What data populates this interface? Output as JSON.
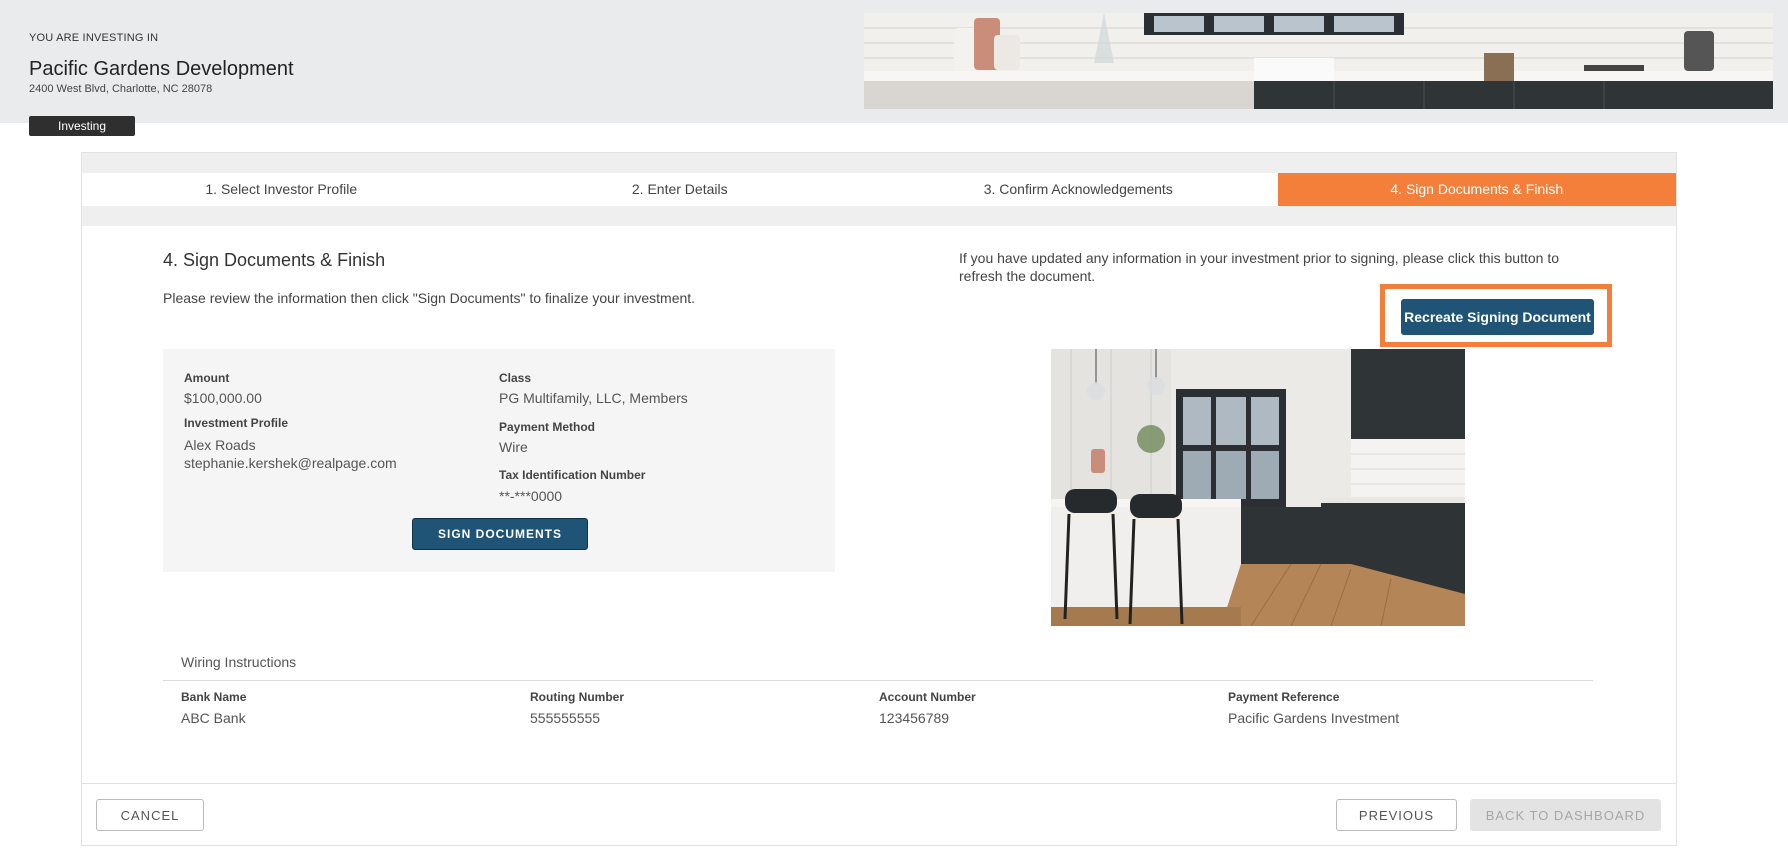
{
  "hero": {
    "kicker": "YOU ARE INVESTING IN",
    "title": "Pacific Gardens Development",
    "address": "2400 West Blvd, Charlotte, NC 28078",
    "badge": "Investing"
  },
  "steps": [
    {
      "label": "1. Select Investor Profile",
      "active": false
    },
    {
      "label": "2. Enter Details",
      "active": false
    },
    {
      "label": "3. Confirm Acknowledgements",
      "active": false
    },
    {
      "label": "4. Sign Documents & Finish",
      "active": true
    }
  ],
  "section": {
    "title": "4. Sign Documents & Finish",
    "description": "Please review the information then click \"Sign Documents\" to finalize your investment."
  },
  "summary": {
    "amount_label": "Amount",
    "amount": "$100,000.00",
    "profile_label": "Investment Profile",
    "profile_name": "Alex Roads",
    "profile_email": "stephanie.kershek@realpage.com",
    "class_label": "Class",
    "class": "PG Multifamily, LLC, Members",
    "payment_label": "Payment Method",
    "payment": "Wire",
    "tin_label": "Tax Identification Number",
    "tin": "**-***0000",
    "sign_button": "SIGN DOCUMENTS"
  },
  "refresh": {
    "note": "If you have updated any information in your investment prior to signing, please click this button to refresh the document.",
    "button": "Recreate Signing Document"
  },
  "wiring": {
    "title": "Wiring Instructions",
    "bank_label": "Bank Name",
    "bank": "ABC Bank",
    "routing_label": "Routing Number",
    "routing": "555555555",
    "account_label": "Account Number",
    "account": "123456789",
    "reference_label": "Payment Reference",
    "reference": "Pacific Gardens Investment"
  },
  "footer": {
    "cancel": "CANCEL",
    "previous": "PREVIOUS",
    "back": "BACK TO DASHBOARD"
  },
  "colors": {
    "accent": "#f47f3a",
    "primary": "#1f5476"
  }
}
